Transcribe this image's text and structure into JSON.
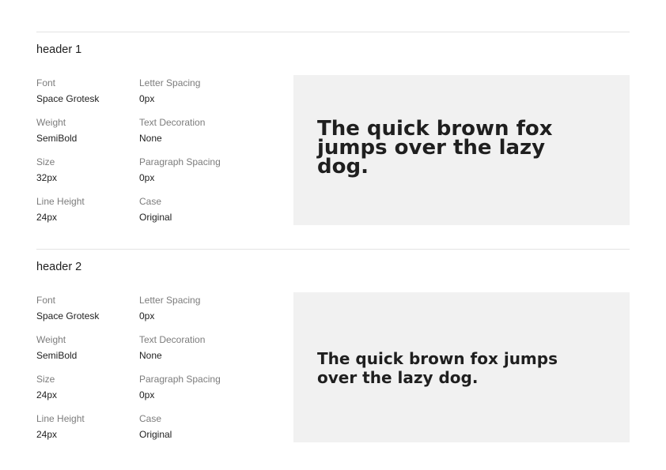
{
  "styles": [
    {
      "name": "header 1",
      "font_label": "Font",
      "font": "Space Grotesk",
      "weight_label": "Weight",
      "weight": "SemiBold",
      "size_label": "Size",
      "size": "32px",
      "line_height_label": "Line Height",
      "line_height": "24px",
      "letter_spacing_label": "Letter Spacing",
      "letter_spacing": "0px",
      "text_decoration_label": "Text Decoration",
      "text_decoration": "None",
      "paragraph_spacing_label": "Paragraph Spacing",
      "paragraph_spacing": "0px",
      "case_label": "Case",
      "case": "Original",
      "preview": "The quick brown fox jumps over the lazy dog."
    },
    {
      "name": "header 2",
      "font_label": "Font",
      "font": "Space Grotesk",
      "weight_label": "Weight",
      "weight": "SemiBold",
      "size_label": "Size",
      "size": "24px",
      "line_height_label": "Line Height",
      "line_height": "24px",
      "letter_spacing_label": "Letter Spacing",
      "letter_spacing": "0px",
      "text_decoration_label": "Text Decoration",
      "text_decoration": "None",
      "paragraph_spacing_label": "Paragraph Spacing",
      "paragraph_spacing": "0px",
      "case_label": "Case",
      "case": "Original",
      "preview": "The quick brown fox jumps over the lazy dog."
    }
  ],
  "colors": {
    "text": "#1f1f1f",
    "label": "#7c7c7c",
    "divider": "#e3e3e3",
    "preview_background": "#f1f1f1"
  }
}
